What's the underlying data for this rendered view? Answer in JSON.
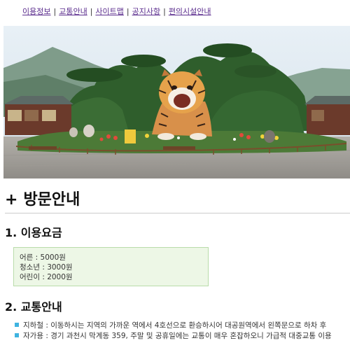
{
  "nav": {
    "items": [
      "이용정보",
      "교통안내",
      "사이트맵",
      "공지사항",
      "편의시설안내"
    ],
    "separator": "|"
  },
  "hero": {
    "alt": "zoo-entrance-tiger-statue",
    "colors": {
      "sky": "#dfe9f1",
      "mountain": "#7a9a86",
      "trees": "#2d5a2a",
      "plaza": "#a9a6a1",
      "tiger": "#e6a24b"
    }
  },
  "page": {
    "title_prefix": "+",
    "title": "방문안내"
  },
  "fee": {
    "heading": "1. 이용요금",
    "rows": [
      "어른 : 5000원",
      "청소년 : 3000원",
      "어린이 : 2000원"
    ]
  },
  "traffic": {
    "heading": "2. 교통안내",
    "items": [
      "지하철 : 이동하시는 지역의 가까운 역에서 4호선으로 환승하시어 대공원역에서 왼쪽문으로 하차 후",
      "자가용 : 경기 과천시 막계동 359, 주말 및 공휴일에는 교통이 매우 혼잡하오니 가급적 대중교통 이용"
    ]
  }
}
